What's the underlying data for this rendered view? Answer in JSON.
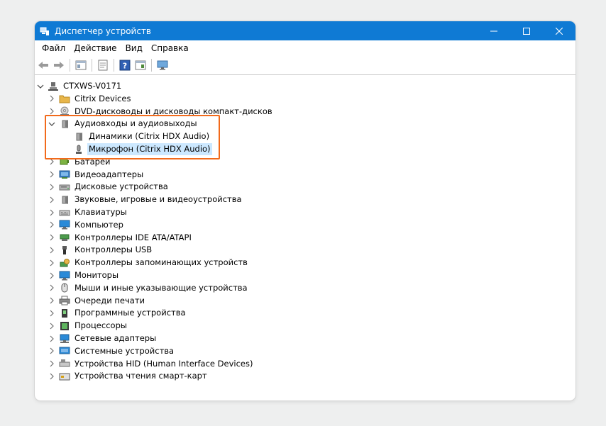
{
  "window": {
    "title": "Диспетчер устройств",
    "title_bar_color": "#0f7ad4"
  },
  "menu": [
    "Файл",
    "Действие",
    "Вид",
    "Справка"
  ],
  "toolbar": {
    "buttons": [
      "back-arrow-icon",
      "forward-arrow-icon",
      "properties-icon",
      "update-driver-icon",
      "help-icon",
      "view-icon",
      "monitor-scan-icon"
    ]
  },
  "tree": {
    "root": {
      "label": "CTXWS-V0171",
      "icon": "computer-icon",
      "expanded": true
    },
    "items": [
      {
        "label": "Citrix Devices",
        "icon": "folder-icon",
        "expanded": false
      },
      {
        "label": "DVD-дисководы и дисководы компакт-дисков",
        "icon": "dvd-icon",
        "expanded": false
      },
      {
        "label": "Аудиовходы и аудиовыходы",
        "icon": "speaker-icon",
        "expanded": true,
        "children": [
          {
            "label": "Динамики (Citrix HDX Audio)",
            "icon": "speaker-icon",
            "selected": false
          },
          {
            "label": "Микрофон (Citrix HDX Audio)",
            "icon": "microphone-icon",
            "selected": true
          }
        ]
      },
      {
        "label": "Батареи",
        "icon": "battery-icon",
        "expanded": false
      },
      {
        "label": "Видеоадаптеры",
        "icon": "display-adapter-icon",
        "expanded": false
      },
      {
        "label": "Дисковые устройства",
        "icon": "disk-icon",
        "expanded": false
      },
      {
        "label": "Звуковые, игровые и видеоустройства",
        "icon": "speaker-icon",
        "expanded": false
      },
      {
        "label": "Клавиатуры",
        "icon": "keyboard-icon",
        "expanded": false
      },
      {
        "label": "Компьютер",
        "icon": "monitor-icon",
        "expanded": false
      },
      {
        "label": "Контроллеры IDE ATA/ATAPI",
        "icon": "ide-controller-icon",
        "expanded": false
      },
      {
        "label": "Контроллеры USB",
        "icon": "usb-icon",
        "expanded": false
      },
      {
        "label": "Контроллеры запоминающих устройств",
        "icon": "storage-controller-icon",
        "expanded": false
      },
      {
        "label": "Мониторы",
        "icon": "monitor-icon",
        "expanded": false
      },
      {
        "label": "Мыши и иные указывающие устройства",
        "icon": "mouse-icon",
        "expanded": false
      },
      {
        "label": "Очереди печати",
        "icon": "printer-icon",
        "expanded": false
      },
      {
        "label": "Программные устройства",
        "icon": "software-device-icon",
        "expanded": false
      },
      {
        "label": "Процессоры",
        "icon": "processor-icon",
        "expanded": false
      },
      {
        "label": "Сетевые адаптеры",
        "icon": "network-adapter-icon",
        "expanded": false
      },
      {
        "label": "Системные устройства",
        "icon": "system-device-icon",
        "expanded": false
      },
      {
        "label": "Устройства HID (Human Interface Devices)",
        "icon": "hid-icon",
        "expanded": false
      },
      {
        "label": "Устройства чтения смарт-карт",
        "icon": "smartcard-icon",
        "expanded": false
      }
    ]
  },
  "highlight_color": "#f26a1b"
}
